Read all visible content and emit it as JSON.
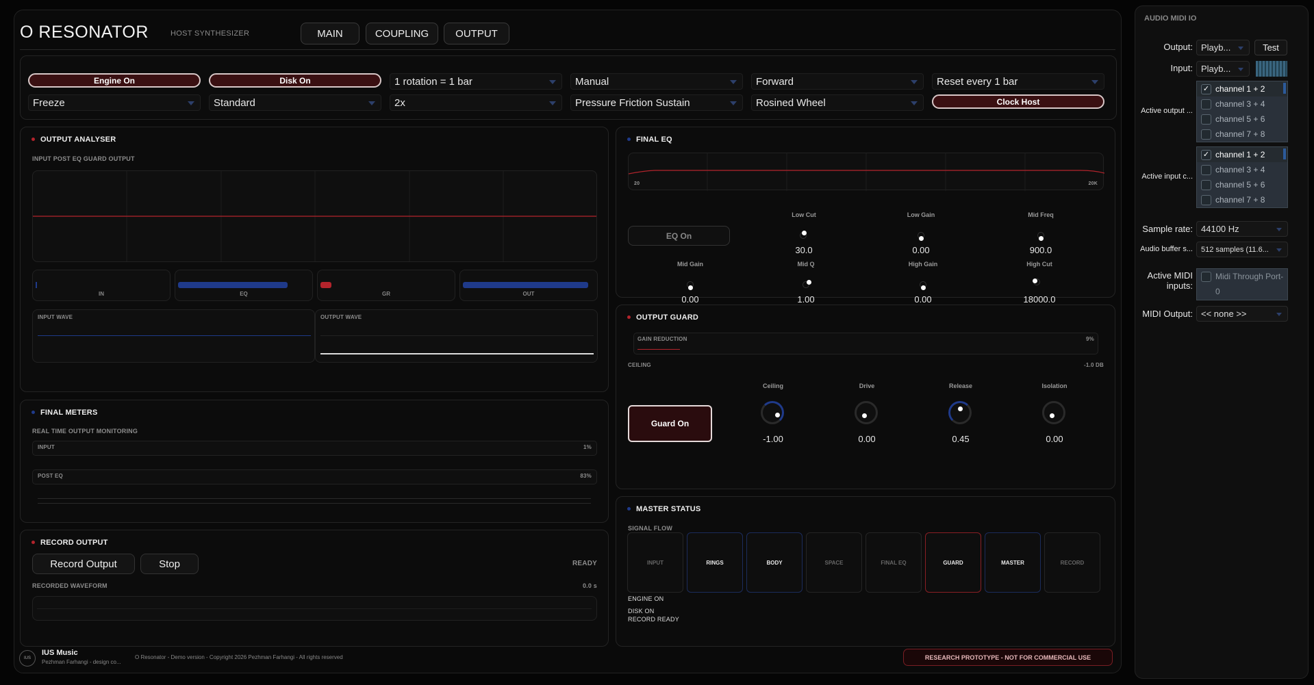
{
  "app": {
    "title": "O RESONATOR",
    "subtitle": "HOST SYNTHESIZER"
  },
  "tabs": [
    "MAIN",
    "COUPLING",
    "OUTPUT"
  ],
  "controls": {
    "engine": "Engine On",
    "disk": "Disk On",
    "rotation": "1 rotation = 1 bar",
    "mode": "Manual",
    "direction": "Forward",
    "reset": "Reset every 1 bar",
    "freeze": "Freeze",
    "standard": "Standard",
    "multiplier": "2x",
    "friction": "Pressure Friction Sustain",
    "wheel": "Rosined Wheel",
    "clock": "Clock Host"
  },
  "analyser": {
    "title": "OUTPUT ANALYSER",
    "legend": "INPUT  POST EQ  GUARD  OUTPUT",
    "meters": [
      {
        "label": "IN",
        "level": 0.01
      },
      {
        "label": "EQ",
        "level": 0.9
      },
      {
        "label": "GR",
        "level": 0.08
      },
      {
        "label": "OUT",
        "level": 1.0
      }
    ],
    "input_wave": "INPUT WAVE",
    "output_wave": "OUTPUT WAVE"
  },
  "meters": {
    "title": "FINAL METERS",
    "subtitle": "REAL TIME OUTPUT MONITORING",
    "input_label": "INPUT",
    "input_value": "1%",
    "posteq_label": "POST EQ",
    "posteq_value": "83%"
  },
  "record": {
    "title": "RECORD OUTPUT",
    "record_btn": "Record Output",
    "stop_btn": "Stop",
    "status": "READY",
    "waveform_label": "RECORDED WAVEFORM",
    "time": "0.0 s"
  },
  "eq": {
    "title": "FINAL EQ",
    "freq_low": "20",
    "freq_high": "20K",
    "eq_on": "EQ On",
    "row1": [
      {
        "label": "Low Cut",
        "value": "30.0"
      },
      {
        "label": "Low Gain",
        "value": "0.00"
      },
      {
        "label": "Mid Freq",
        "value": "900.0"
      }
    ],
    "row2": [
      {
        "label": "Mid Gain",
        "value": "0.00"
      },
      {
        "label": "Mid Q",
        "value": "1.00"
      },
      {
        "label": "High Gain",
        "value": "0.00"
      },
      {
        "label": "High Cut",
        "value": "18000.0"
      }
    ]
  },
  "guard": {
    "title": "OUTPUT GUARD",
    "gr_label": "GAIN REDUCTION",
    "gr_value": "9%",
    "ceiling_label": "CEILING",
    "ceiling_value": "-1.0 DB",
    "guard_on": "Guard On",
    "knobs": [
      {
        "label": "Ceiling",
        "value": "-1.00"
      },
      {
        "label": "Drive",
        "value": "0.00"
      },
      {
        "label": "Release",
        "value": "0.45"
      },
      {
        "label": "Isolation",
        "value": "0.00"
      }
    ]
  },
  "status": {
    "title": "MASTER STATUS",
    "flow_label": "SIGNAL FLOW",
    "stages": [
      "INPUT",
      "RINGS",
      "BODY",
      "SPACE",
      "FINAL EQ",
      "GUARD",
      "MASTER",
      "RECORD"
    ],
    "line1": "ENGINE ON",
    "line2": "DISK ON",
    "line3": "RECORD READY"
  },
  "footer": {
    "logo": "IUS",
    "brand": "IUS Music",
    "credit": "Pezhman Farhangi - design co...",
    "copyright": "O Resonator - Demo version - Copyright 2026 Pezhman Farhangi - All rights reserved",
    "notice": "RESEARCH PROTOTYPE - NOT FOR COMMERCIAL USE"
  },
  "side": {
    "title": "AUDIO MIDI IO",
    "output_label": "Output:",
    "output_value": "Playb...",
    "test_btn": "Test",
    "input_label": "Input:",
    "input_value": "Playb...",
    "active_output_label": "Active output ...",
    "active_input_label": "Active input c...",
    "output_channels": [
      {
        "name": "channel 1 + 2",
        "checked": true
      },
      {
        "name": "channel 3 + 4",
        "checked": false
      },
      {
        "name": "channel 5 + 6",
        "checked": false
      },
      {
        "name": "channel 7 + 8",
        "checked": false
      }
    ],
    "input_channels": [
      {
        "name": "channel 1 + 2",
        "checked": true
      },
      {
        "name": "channel 3 + 4",
        "checked": false
      },
      {
        "name": "channel 5 + 6",
        "checked": false
      },
      {
        "name": "channel 7 + 8",
        "checked": false
      }
    ],
    "sample_rate_label": "Sample rate:",
    "sample_rate": "44100 Hz",
    "buffer_label": "Audio buffer s...",
    "buffer": "512 samples (11.6...",
    "midi_inputs_label": "Active MIDI inputs:",
    "midi_input": "Midi Through Port-0",
    "midi_output_label": "MIDI Output:",
    "midi_output": "<< none >>"
  },
  "colors": {
    "accent_red": "#b3242c",
    "accent_blue": "#1f3a8a",
    "panel": "#0c0c0c"
  }
}
